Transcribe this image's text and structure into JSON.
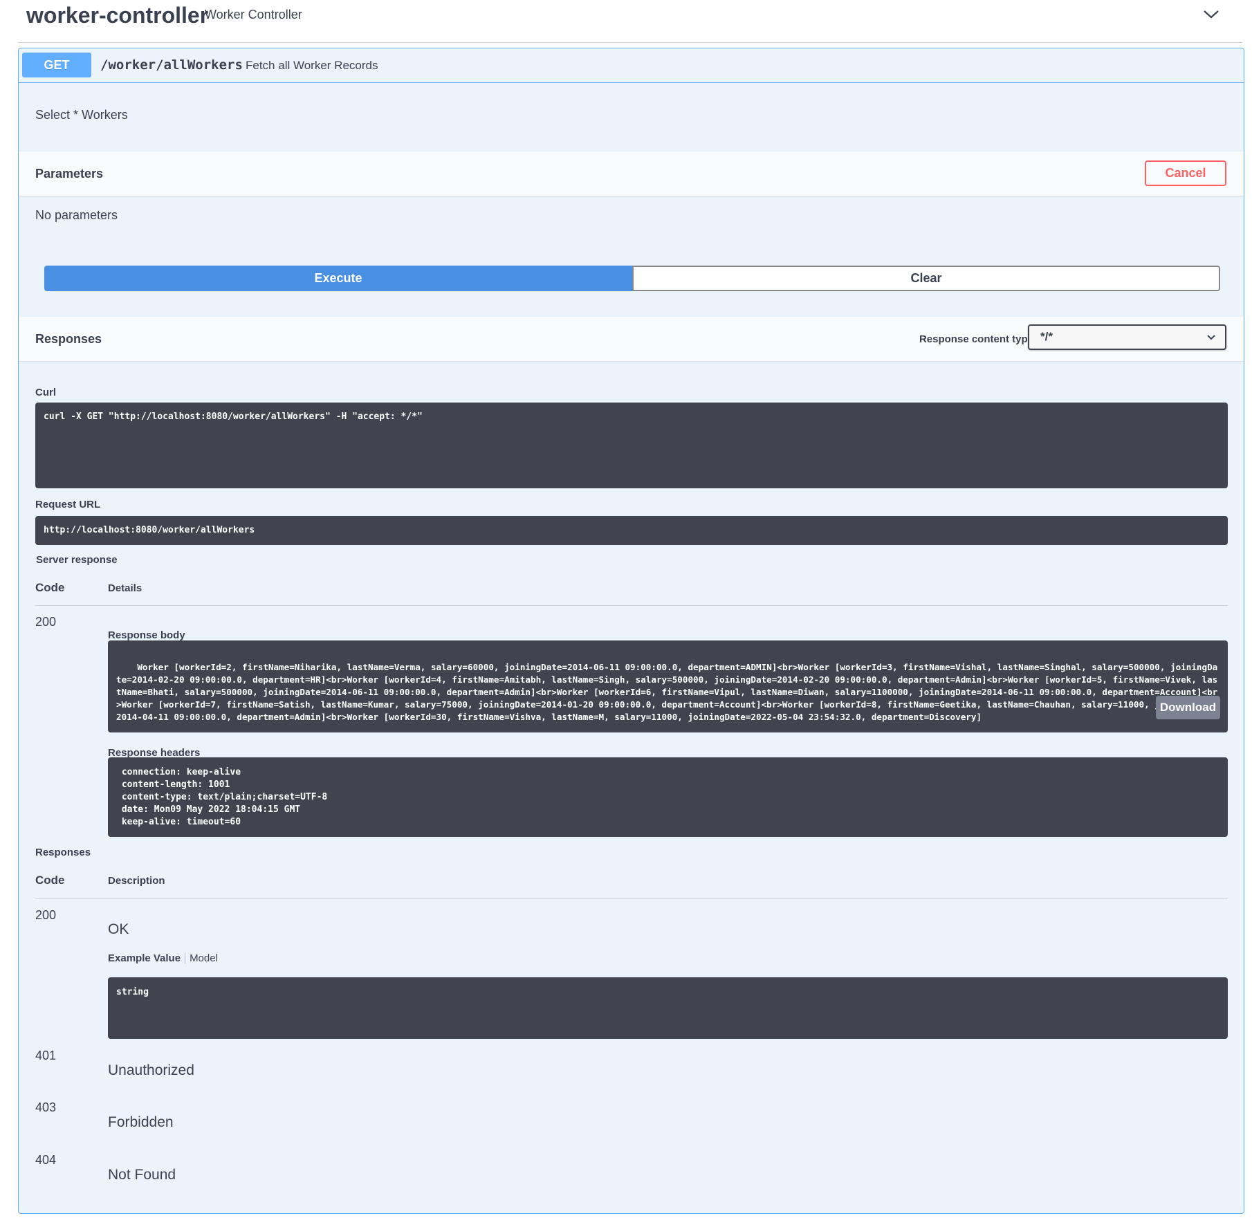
{
  "tag": {
    "name": "worker-controller",
    "description": "Worker Controller"
  },
  "operation": {
    "method": "GET",
    "path": "/worker/allWorkers",
    "summary": "Fetch all Worker Records",
    "description": "Select * Workers"
  },
  "parameters": {
    "title": "Parameters",
    "cancel_label": "Cancel",
    "empty_text": "No parameters"
  },
  "actions": {
    "execute_label": "Execute",
    "clear_label": "Clear"
  },
  "responses_header": {
    "title": "Responses",
    "content_type_label": "Response content type",
    "content_type_value": "*/*"
  },
  "live": {
    "curl_label": "Curl",
    "curl_command": "curl -X GET \"http://localhost:8080/worker/allWorkers\" -H \"accept: */*\"",
    "request_url_label": "Request URL",
    "request_url": "http://localhost:8080/worker/allWorkers",
    "server_response_label": "Server response",
    "code_header": "Code",
    "details_header": "Details",
    "code": "200",
    "response_body_label": "Response body",
    "response_body": "Worker [workerId=2, firstName=Niharika, lastName=Verma, salary=60000, joiningDate=2014-06-11 09:00:00.0, department=ADMIN]<br>Worker [workerId=3, firstName=Vishal, lastName=Singhal, salary=500000, joiningDate=2014-02-20 09:00:00.0, department=HR]<br>Worker [workerId=4, firstName=Amitabh, lastName=Singh, salary=500000, joiningDate=2014-02-20 09:00:00.0, department=Admin]<br>Worker [workerId=5, firstName=Vivek, lastName=Bhati, salary=500000, joiningDate=2014-06-11 09:00:00.0, department=Admin]<br>Worker [workerId=6, firstName=Vipul, lastName=Diwan, salary=1100000, joiningDate=2014-06-11 09:00:00.0, department=Account]<br>Worker [workerId=7, firstName=Satish, lastName=Kumar, salary=75000, joiningDate=2014-01-20 09:00:00.0, department=Account]<br>Worker [workerId=8, firstName=Geetika, lastName=Chauhan, salary=11000, joiningDate=2014-04-11 09:00:00.0, department=Admin]<br>Worker [workerId=30, firstName=Vishva, lastName=M, salary=11000, joiningDate=2022-05-04 23:54:32.0, department=Discovery]",
    "download_label": "Download",
    "response_headers_label": "Response headers",
    "response_headers": " connection: keep-alive\n content-length: 1001\n content-type: text/plain;charset=UTF-8\n date: Mon09 May 2022 18:04:15 GMT\n keep-alive: timeout=60"
  },
  "documented": {
    "title": "Responses",
    "code_header": "Code",
    "description_header": "Description",
    "items": [
      {
        "code": "200",
        "description": "OK"
      },
      {
        "code": "401",
        "description": "Unauthorized"
      },
      {
        "code": "403",
        "description": "Forbidden"
      },
      {
        "code": "404",
        "description": "Not Found"
      }
    ],
    "example_tab": "Example Value",
    "model_tab": "Model",
    "example_value": "string"
  },
  "colors": {
    "get_accent": "#61affe",
    "block_bg": "#ebf3fb",
    "execute_blue": "#4990e2",
    "cancel_red": "#ff6060",
    "code_bg": "#41444e"
  },
  "icons": {
    "tag_toggle": "chevron-down-icon",
    "select_arrow": "chevron-down-icon"
  }
}
